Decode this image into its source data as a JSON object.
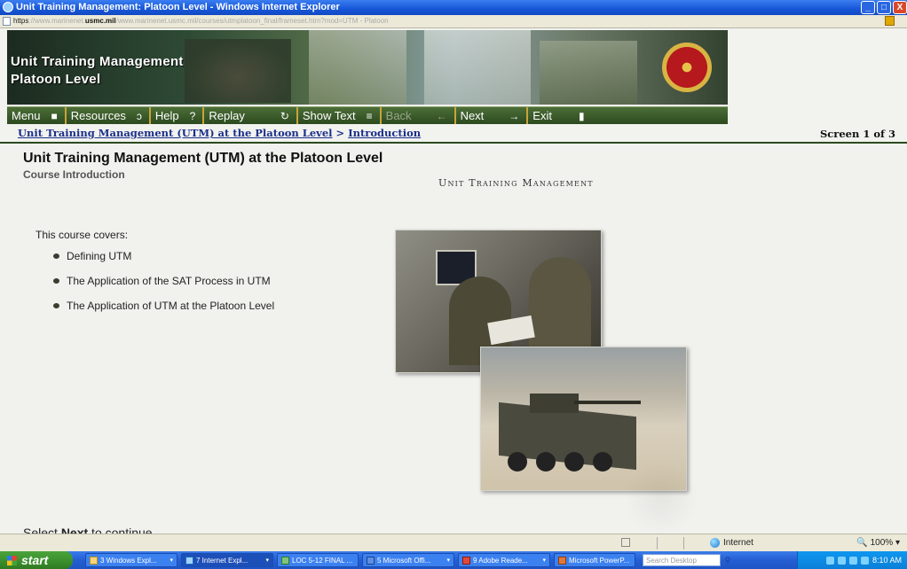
{
  "window": {
    "title": "Unit Training Management: Platoon Level - Windows Internet Explorer",
    "buttons": {
      "minimize": "_",
      "maximize": "□",
      "close": "X"
    }
  },
  "address_bar": {
    "protocol": "https",
    "url_pre": "://www.marinenet.",
    "url_domain": "usmc.mil",
    "url_post": "/www.marinenet.usmc.mil/courses/utmplatoon_final/frameset.htm?mod=UTM - Platoon"
  },
  "banner": {
    "title_line1": "Unit Training Management",
    "title_line2": "Platoon Level"
  },
  "nav": {
    "menu": "Menu",
    "resources": "Resources",
    "help": "Help",
    "replay": "Replay",
    "show_text": "Show Text",
    "back": "Back",
    "next": "Next",
    "exit": "Exit",
    "icons": {
      "menu": "■",
      "resources": "ↄ",
      "help": "?",
      "replay": "↻",
      "show_text": "≡",
      "back": "←",
      "next": "→",
      "exit": "▮"
    }
  },
  "breadcrumb": {
    "course_link": "Unit Training Management (UTM) at the Platoon Level",
    "separator": " > ",
    "section_link": "Introduction"
  },
  "screen_counter": "Screen 1 of 3",
  "content": {
    "title": "Unit Training Management (UTM) at the Platoon Level",
    "subtitle": "Course Introduction",
    "heading": "Unit Training Management",
    "intro": "This course covers:",
    "bullets": [
      "Defining UTM",
      "The Application of the SAT Process in UTM",
      "The Application of UTM at the Platoon Level"
    ],
    "select_prefix": "Select ",
    "select_next": "Next",
    "select_suffix": " to continue."
  },
  "status_bar": {
    "zone": "Internet",
    "zoom": "100%"
  },
  "taskbar": {
    "start": "start",
    "tasks": [
      "3 Windows Expl...",
      "7 Internet Expl...",
      "LOC 5-12 FINAL ...",
      "5 Microsoft Offi...",
      "9 Adobe Reade...",
      "Microsoft PowerP..."
    ],
    "search_placeholder": "Search Desktop",
    "clock": "8:10 AM"
  },
  "colors": {
    "title_bar": "#1656d8",
    "nav_green": "#2c4a1e",
    "nav_border_gold": "#c8a43a",
    "breadcrumb_link": "#1a2f8a",
    "taskbar_blue": "#245ed3",
    "start_green": "#3a8d2c"
  }
}
